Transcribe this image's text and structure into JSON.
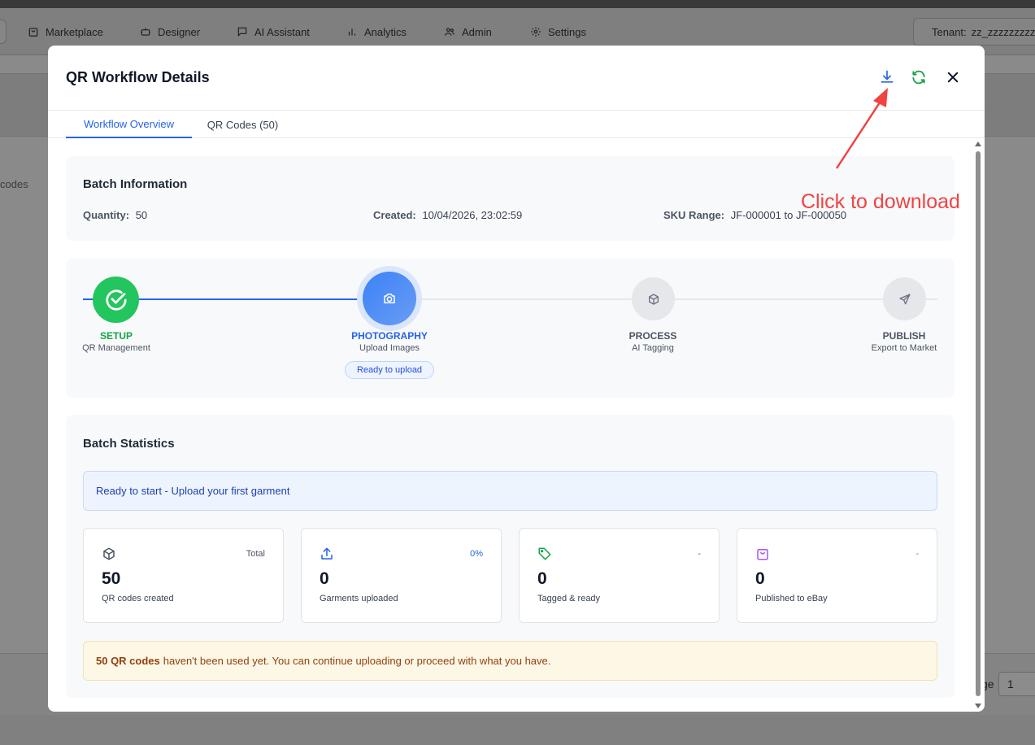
{
  "app_nav": {
    "items": [
      {
        "label": "Marketplace",
        "icon": "shopping-bag-icon"
      },
      {
        "label": "Designer",
        "icon": "robot-icon"
      },
      {
        "label": "AI Assistant",
        "icon": "chat-bubble-icon"
      },
      {
        "label": "Analytics",
        "icon": "bar-chart-icon"
      },
      {
        "label": "Admin",
        "icon": "users-icon"
      },
      {
        "label": "Settings",
        "icon": "gear-icon"
      }
    ],
    "tenant_label": "Tenant:",
    "tenant_value": "zz_zzzzzzzzzzz"
  },
  "background": {
    "codes_text": "codes",
    "page_label": "ge",
    "page_value": "1"
  },
  "modal": {
    "title": "QR Workflow Details",
    "actions": {
      "download_icon": "download-icon",
      "refresh_icon": "refresh-icon",
      "close_icon": "close-icon"
    },
    "tabs": [
      {
        "label": "Workflow Overview",
        "active": true
      },
      {
        "label": "QR Codes (50)",
        "active": false
      }
    ],
    "batch_info": {
      "title": "Batch Information",
      "quantity_label": "Quantity:",
      "quantity_value": "50",
      "created_label": "Created:",
      "created_value": "10/04/2026, 23:02:59",
      "sku_label": "SKU Range:",
      "sku_value": "JF-000001 to JF-000050"
    },
    "workflow": {
      "steps": [
        {
          "name": "SETUP",
          "sub": "QR Management",
          "state": "complete",
          "icon": "check-circle-icon"
        },
        {
          "name": "PHOTOGRAPHY",
          "sub": "Upload Images",
          "state": "active",
          "icon": "camera-icon"
        },
        {
          "name": "PROCESS",
          "sub": "AI Tagging",
          "state": "pending",
          "icon": "package-icon"
        },
        {
          "name": "PUBLISH",
          "sub": "Export to Market",
          "state": "pending",
          "icon": "send-icon"
        }
      ],
      "status_pill": "Ready to upload"
    },
    "stats": {
      "title": "Batch Statistics",
      "banner": "Ready to start - Upload your first garment",
      "cards": [
        {
          "icon": "package-icon",
          "tag": "Total",
          "value": "50",
          "label": "QR codes created"
        },
        {
          "icon": "upload-icon",
          "tag": "0%",
          "value": "0",
          "label": "Garments uploaded"
        },
        {
          "icon": "tag-icon",
          "tag": "-",
          "value": "0",
          "label": "Tagged & ready"
        },
        {
          "icon": "shopping-bag-icon",
          "tag": "-",
          "value": "0",
          "label": "Published to eBay"
        }
      ],
      "notice_bold": "50 QR codes",
      "notice_text": "haven't been used yet. You can continue uploading or proceed with what you have."
    }
  },
  "annotation": {
    "text": "Click to download",
    "color": "#ef4444"
  },
  "colors": {
    "accent": "#2563eb",
    "success": "#22c55e",
    "refresh": "#16a34a",
    "warning_text": "#92400e",
    "purple": "#a855f7"
  }
}
